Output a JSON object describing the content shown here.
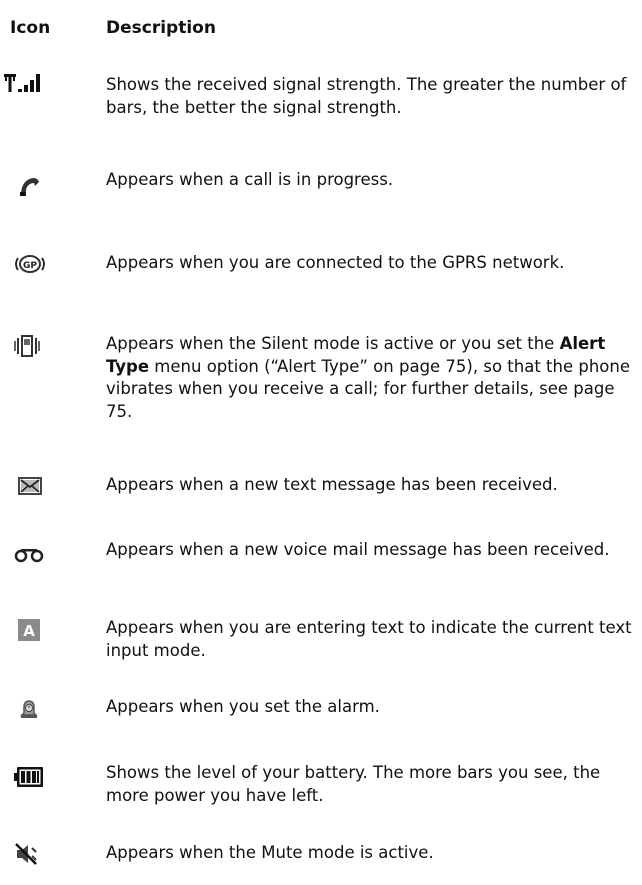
{
  "header": {
    "icon_col": "Icon",
    "desc_col": "Description"
  },
  "rows": [
    {
      "icon": "signal-strength-icon",
      "text": "Shows the received signal strength. The greater the number of bars, the better the signal strength."
    },
    {
      "icon": "call-in-progress-icon",
      "text": "Appears when a call is in progress."
    },
    {
      "icon": "gprs-icon",
      "icon_label": "GP",
      "text": "Appears when you are connected to the GPRS network."
    },
    {
      "icon": "vibrate-icon",
      "text_pre": "Appears when the Silent mode is active or you set the ",
      "text_bold": "Alert Type",
      "text_post": " menu option (“Alert Type” on page 75), so that the phone vibrates when you receive a call; for further details, see page 75."
    },
    {
      "icon": "text-message-icon",
      "text": "Appears when a new text message has been received."
    },
    {
      "icon": "voice-mail-icon",
      "text": "Appears when a new voice mail message has been received."
    },
    {
      "icon": "text-input-mode-icon",
      "icon_label": "A",
      "text": "Appears when you are entering text to indicate the current text input mode."
    },
    {
      "icon": "alarm-icon",
      "text": "Appears when you set the alarm."
    },
    {
      "icon": "battery-icon",
      "text": "Shows the level of your battery. The more bars you see, the more power you have left."
    },
    {
      "icon": "mute-icon",
      "text": "Appears when the Mute mode is active."
    }
  ]
}
